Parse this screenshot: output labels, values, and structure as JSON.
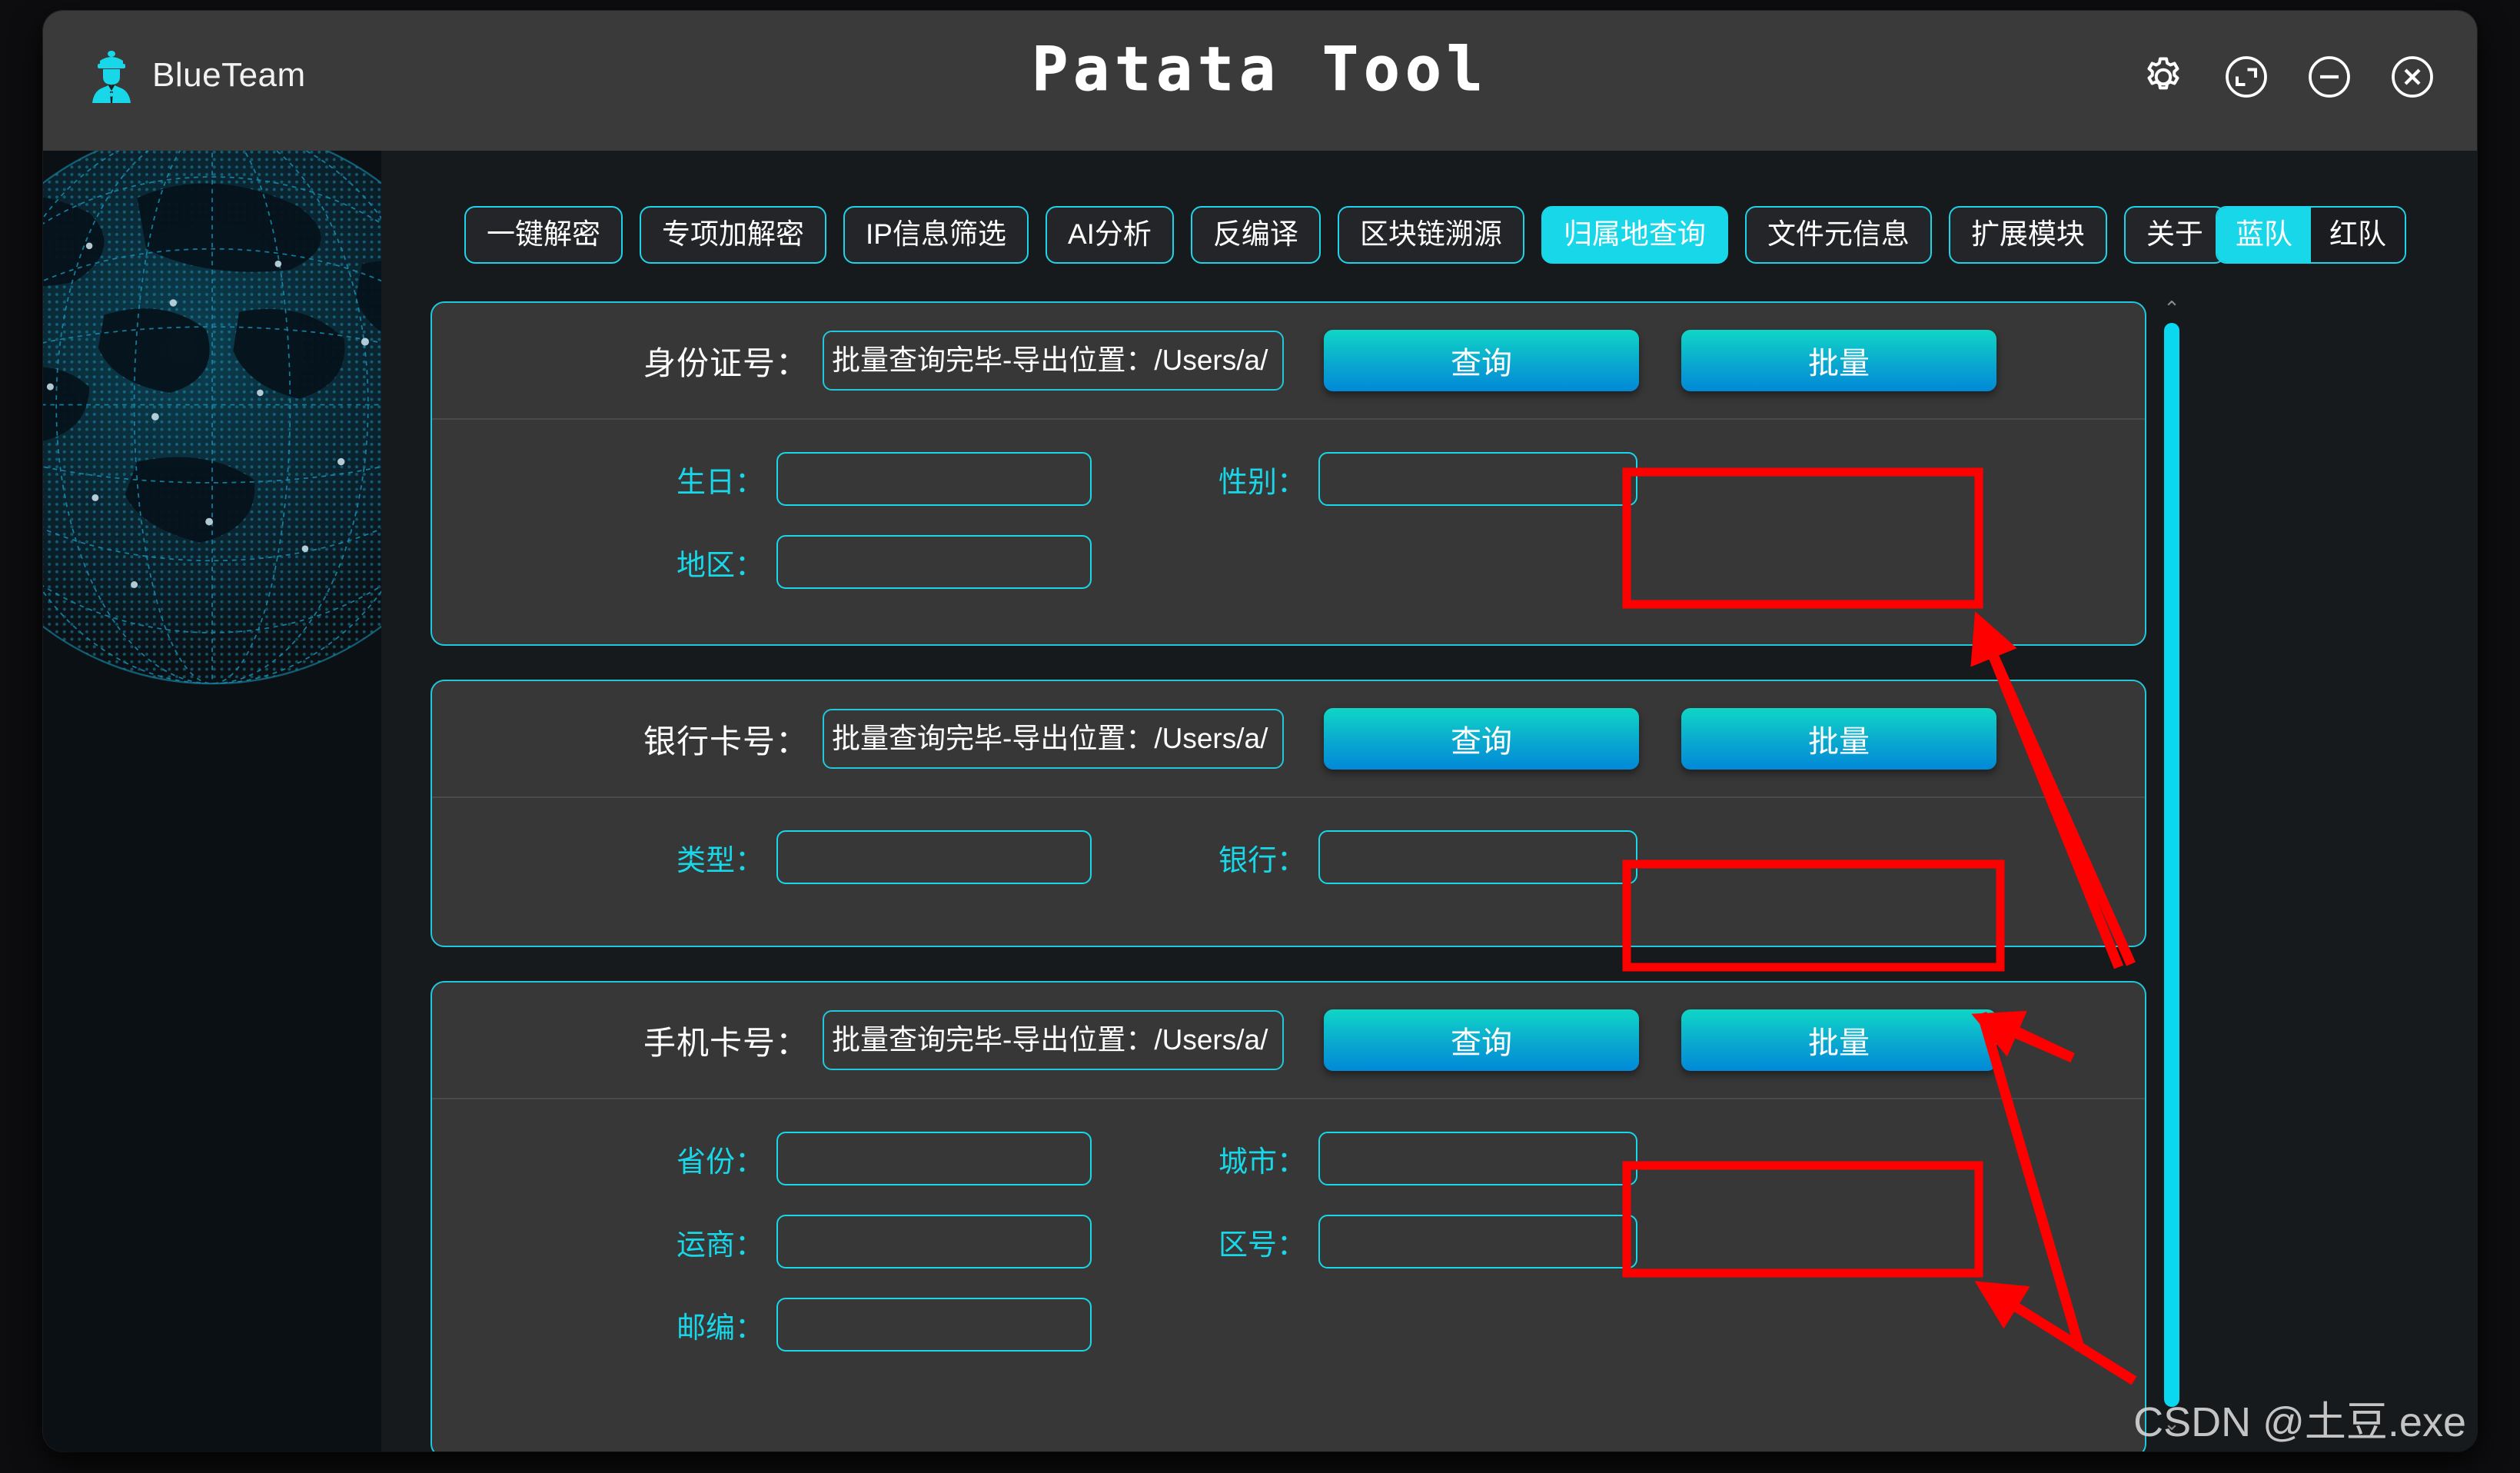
{
  "window": {
    "title": "Patata Tool",
    "brand_label": "BlueTeam",
    "controls": [
      {
        "name": "settings-button",
        "icon": "gear-icon"
      },
      {
        "name": "maximize-button",
        "icon": "maximize-icon"
      },
      {
        "name": "minimize-button",
        "icon": "minimize-icon"
      },
      {
        "name": "close-button",
        "icon": "close-icon"
      }
    ]
  },
  "tabs": [
    {
      "label": "一键解密",
      "active": false
    },
    {
      "label": "专项加解密",
      "active": false
    },
    {
      "label": "IP信息筛选",
      "active": false
    },
    {
      "label": "AI分析",
      "active": false
    },
    {
      "label": "反编译",
      "active": false
    },
    {
      "label": "区块链溯源",
      "active": false
    },
    {
      "label": "归属地查询",
      "active": true
    },
    {
      "label": "文件元信息",
      "active": false
    },
    {
      "label": "扩展模块",
      "active": false
    },
    {
      "label": "关于",
      "active": false
    }
  ],
  "team_toggle": {
    "blue_label": "蓝队",
    "red_label": "红队",
    "active": "蓝队"
  },
  "buttons": {
    "query_label": "查询",
    "batch_label": "批量"
  },
  "panels": [
    {
      "id": "id-card",
      "head_label": "身份证号：",
      "input_value": "批量查询完毕-导出位置：/Users/a/",
      "input_placeholder": "",
      "fields": [
        {
          "label": "生日：",
          "value": "",
          "col": "a",
          "row": 0
        },
        {
          "label": "性别：",
          "value": "",
          "col": "b",
          "row": 0
        },
        {
          "label": "地区：",
          "value": "",
          "col": "a",
          "row": 1
        }
      ]
    },
    {
      "id": "bank-card",
      "head_label": "银行卡号：",
      "input_value": "批量查询完毕-导出位置：/Users/a/",
      "input_placeholder": "",
      "fields": [
        {
          "label": "类型：",
          "value": "",
          "col": "a",
          "row": 0
        },
        {
          "label": "银行：",
          "value": "",
          "col": "b",
          "row": 0
        }
      ]
    },
    {
      "id": "phone-card",
      "head_label": "手机卡号：",
      "input_value": "批量查询完毕-导出位置：/Users/a/",
      "input_placeholder": "",
      "fields": [
        {
          "label": "省份：",
          "value": "",
          "col": "a",
          "row": 0
        },
        {
          "label": "城市：",
          "value": "",
          "col": "b",
          "row": 0
        },
        {
          "label": "运商：",
          "value": "",
          "col": "a",
          "row": 1
        },
        {
          "label": "区号：",
          "value": "",
          "col": "b",
          "row": 1
        },
        {
          "label": "邮编：",
          "value": "",
          "col": "a",
          "row": 2
        }
      ]
    }
  ],
  "scrollbar": {
    "up_arrow": "⌃",
    "down_arrow": "⌄"
  },
  "watermark": "CSDN @土豆.exe",
  "colors": {
    "accent_cyan": "#18d7e8",
    "button_gradient_top": "#0fd6c6",
    "button_gradient_bottom": "#0189d8",
    "annotation_red": "#ff0000",
    "titlebar_bg": "#3a3a3a",
    "panel_bg": "#373737",
    "content_bg": "#161a1d"
  },
  "annotations": {
    "boxes": 3,
    "arrows": 3,
    "color": "#ff0000"
  }
}
